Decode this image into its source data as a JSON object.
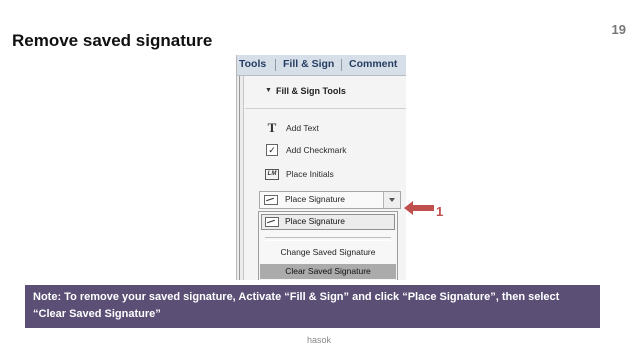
{
  "slide": {
    "title": "Remove saved signature",
    "page_number": "19",
    "footer": "hasok"
  },
  "toolbar": {
    "tabs": [
      {
        "label": "Tools"
      },
      {
        "label": "Fill & Sign"
      },
      {
        "label": "Comment"
      }
    ]
  },
  "panel": {
    "group_title": "Fill & Sign Tools",
    "items": [
      {
        "label": "Add Text",
        "icon": "text-t-icon"
      },
      {
        "label": "Add Checkmark",
        "icon": "checkmark-icon"
      },
      {
        "label": "Place Initials",
        "icon": "initials-icon"
      }
    ],
    "signature_dropdown": {
      "selected": "Place Signature",
      "options": [
        "Place Signature",
        "Change Saved Signature",
        "Clear Saved Signature"
      ]
    }
  },
  "callout": {
    "number": "1",
    "color": "#c0504d"
  },
  "note": {
    "text": "Note: To remove your saved signature, Activate “Fill & Sign” and click “Place Signature”, then select “Clear Saved Signature”",
    "background": "#5b4f76"
  }
}
